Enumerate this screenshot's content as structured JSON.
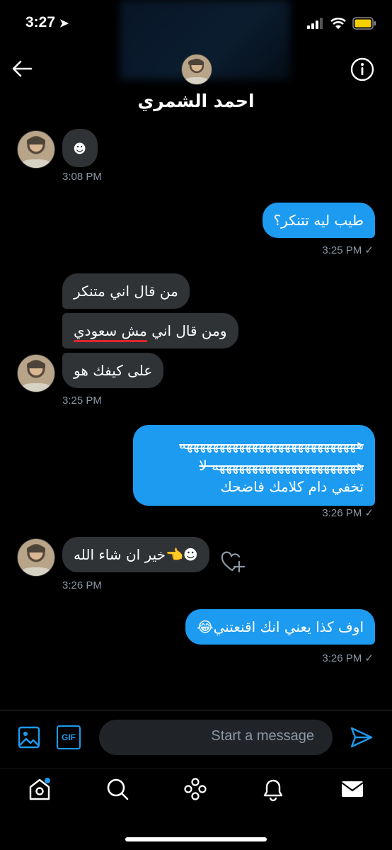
{
  "status_bar": {
    "time": "3:27"
  },
  "header": {
    "name": "احمد الشمري"
  },
  "messages": {
    "m1": {
      "text": "☻",
      "time": "3:08 PM"
    },
    "m2": {
      "text": "طيب ليه تتنكر؟",
      "time": "3:25 PM ✓"
    },
    "m3a": {
      "text": "من قال اني متنكر"
    },
    "m3b_pre": {
      "text": "ومن قال اني "
    },
    "m3b_under": {
      "text": "مش سعودي"
    },
    "m3c": {
      "text": "على كيفك هو",
      "time": "3:25 PM"
    },
    "m4": {
      "line1": "هههههههههههههههههههههههههههه",
      "line2": "ههههههههههههههههههههههه لا",
      "line3": "تخفي دام كلامك فاضحك",
      "time": "3:26 PM ✓"
    },
    "m5": {
      "text": "☻👈خير ان شاء الله",
      "time": "3:26 PM"
    },
    "m6": {
      "text": "اوف كذا يعني انك اقنعتني😂",
      "time": "3:26 PM ✓"
    }
  },
  "composer": {
    "placeholder": "Start a message",
    "gif_label": "GIF"
  },
  "colors": {
    "accent": "#1d9bf0",
    "incoming_bubble": "#2f3336",
    "background": "#000000"
  },
  "icons": [
    "arrow-left-icon",
    "info-icon",
    "smile-icon",
    "heart-plus-icon",
    "image-icon",
    "gif-icon",
    "send-icon",
    "home-icon",
    "search-icon",
    "spaces-icon",
    "bell-icon",
    "mail-icon"
  ]
}
